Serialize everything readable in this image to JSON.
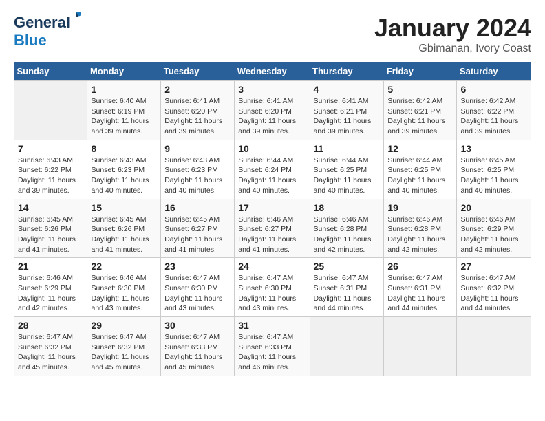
{
  "header": {
    "logo_line1": "General",
    "logo_line2": "Blue",
    "title": "January 2024",
    "subtitle": "Gbimanan, Ivory Coast"
  },
  "days_of_week": [
    "Sunday",
    "Monday",
    "Tuesday",
    "Wednesday",
    "Thursday",
    "Friday",
    "Saturday"
  ],
  "weeks": [
    [
      {
        "day": null
      },
      {
        "day": "1",
        "sunrise": "6:40 AM",
        "sunset": "6:19 PM",
        "daylight": "11 hours and 39 minutes."
      },
      {
        "day": "2",
        "sunrise": "6:41 AM",
        "sunset": "6:20 PM",
        "daylight": "11 hours and 39 minutes."
      },
      {
        "day": "3",
        "sunrise": "6:41 AM",
        "sunset": "6:20 PM",
        "daylight": "11 hours and 39 minutes."
      },
      {
        "day": "4",
        "sunrise": "6:41 AM",
        "sunset": "6:21 PM",
        "daylight": "11 hours and 39 minutes."
      },
      {
        "day": "5",
        "sunrise": "6:42 AM",
        "sunset": "6:21 PM",
        "daylight": "11 hours and 39 minutes."
      },
      {
        "day": "6",
        "sunrise": "6:42 AM",
        "sunset": "6:22 PM",
        "daylight": "11 hours and 39 minutes."
      }
    ],
    [
      {
        "day": "7",
        "sunrise": "6:43 AM",
        "sunset": "6:22 PM",
        "daylight": "11 hours and 39 minutes."
      },
      {
        "day": "8",
        "sunrise": "6:43 AM",
        "sunset": "6:23 PM",
        "daylight": "11 hours and 40 minutes."
      },
      {
        "day": "9",
        "sunrise": "6:43 AM",
        "sunset": "6:23 PM",
        "daylight": "11 hours and 40 minutes."
      },
      {
        "day": "10",
        "sunrise": "6:44 AM",
        "sunset": "6:24 PM",
        "daylight": "11 hours and 40 minutes."
      },
      {
        "day": "11",
        "sunrise": "6:44 AM",
        "sunset": "6:25 PM",
        "daylight": "11 hours and 40 minutes."
      },
      {
        "day": "12",
        "sunrise": "6:44 AM",
        "sunset": "6:25 PM",
        "daylight": "11 hours and 40 minutes."
      },
      {
        "day": "13",
        "sunrise": "6:45 AM",
        "sunset": "6:25 PM",
        "daylight": "11 hours and 40 minutes."
      }
    ],
    [
      {
        "day": "14",
        "sunrise": "6:45 AM",
        "sunset": "6:26 PM",
        "daylight": "11 hours and 41 minutes."
      },
      {
        "day": "15",
        "sunrise": "6:45 AM",
        "sunset": "6:26 PM",
        "daylight": "11 hours and 41 minutes."
      },
      {
        "day": "16",
        "sunrise": "6:45 AM",
        "sunset": "6:27 PM",
        "daylight": "11 hours and 41 minutes."
      },
      {
        "day": "17",
        "sunrise": "6:46 AM",
        "sunset": "6:27 PM",
        "daylight": "11 hours and 41 minutes."
      },
      {
        "day": "18",
        "sunrise": "6:46 AM",
        "sunset": "6:28 PM",
        "daylight": "11 hours and 42 minutes."
      },
      {
        "day": "19",
        "sunrise": "6:46 AM",
        "sunset": "6:28 PM",
        "daylight": "11 hours and 42 minutes."
      },
      {
        "day": "20",
        "sunrise": "6:46 AM",
        "sunset": "6:29 PM",
        "daylight": "11 hours and 42 minutes."
      }
    ],
    [
      {
        "day": "21",
        "sunrise": "6:46 AM",
        "sunset": "6:29 PM",
        "daylight": "11 hours and 42 minutes."
      },
      {
        "day": "22",
        "sunrise": "6:46 AM",
        "sunset": "6:30 PM",
        "daylight": "11 hours and 43 minutes."
      },
      {
        "day": "23",
        "sunrise": "6:47 AM",
        "sunset": "6:30 PM",
        "daylight": "11 hours and 43 minutes."
      },
      {
        "day": "24",
        "sunrise": "6:47 AM",
        "sunset": "6:30 PM",
        "daylight": "11 hours and 43 minutes."
      },
      {
        "day": "25",
        "sunrise": "6:47 AM",
        "sunset": "6:31 PM",
        "daylight": "11 hours and 44 minutes."
      },
      {
        "day": "26",
        "sunrise": "6:47 AM",
        "sunset": "6:31 PM",
        "daylight": "11 hours and 44 minutes."
      },
      {
        "day": "27",
        "sunrise": "6:47 AM",
        "sunset": "6:32 PM",
        "daylight": "11 hours and 44 minutes."
      }
    ],
    [
      {
        "day": "28",
        "sunrise": "6:47 AM",
        "sunset": "6:32 PM",
        "daylight": "11 hours and 45 minutes."
      },
      {
        "day": "29",
        "sunrise": "6:47 AM",
        "sunset": "6:32 PM",
        "daylight": "11 hours and 45 minutes."
      },
      {
        "day": "30",
        "sunrise": "6:47 AM",
        "sunset": "6:33 PM",
        "daylight": "11 hours and 45 minutes."
      },
      {
        "day": "31",
        "sunrise": "6:47 AM",
        "sunset": "6:33 PM",
        "daylight": "11 hours and 46 minutes."
      },
      {
        "day": null
      },
      {
        "day": null
      },
      {
        "day": null
      }
    ]
  ],
  "labels": {
    "sunrise_prefix": "Sunrise: ",
    "sunset_prefix": "Sunset: ",
    "daylight_prefix": "Daylight: "
  }
}
